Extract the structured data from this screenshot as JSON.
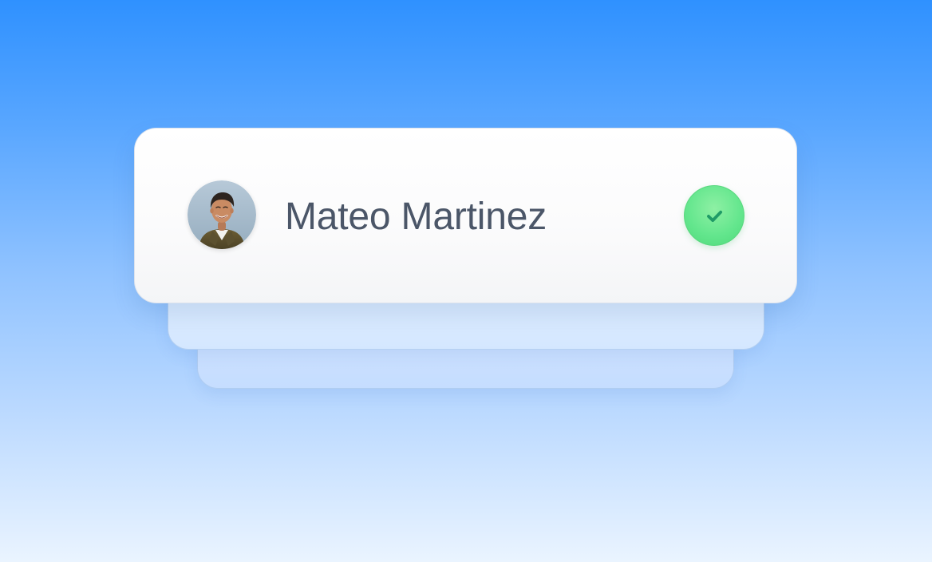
{
  "card": {
    "user_name": "Mateo Martinez"
  },
  "icons": {
    "avatar": "user-avatar-photo",
    "status": "check-icon"
  },
  "colors": {
    "background_top": "#2f91ff",
    "background_bottom": "#eaf4ff",
    "card_background": "#ffffff",
    "name_text": "#4b5668",
    "status_fill": "#63e68d",
    "status_check": "#1f9b67"
  }
}
